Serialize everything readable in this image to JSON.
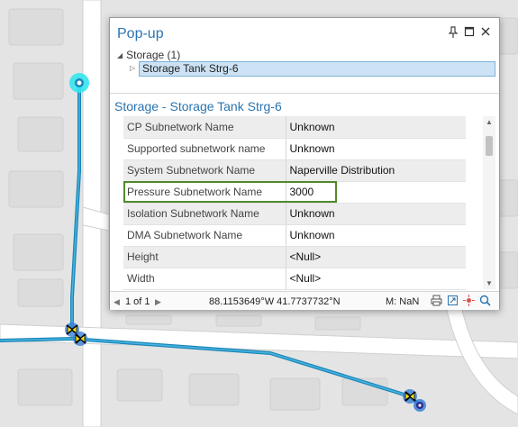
{
  "popup": {
    "title": "Pop-up",
    "layer_label": "Storage (1)",
    "feature_label": "Storage Tank Strg-6",
    "record_title": "Storage - Storage Tank Strg-6",
    "attributes": [
      {
        "name": "CP Subnetwork Name",
        "value": "Unknown"
      },
      {
        "name": "Supported subnetwork name",
        "value": "Unknown"
      },
      {
        "name": "System Subnetwork Name",
        "value": "Naperville Distribution"
      },
      {
        "name": "Pressure Subnetwork Name",
        "value": "3000"
      },
      {
        "name": "Isolation Subnetwork Name",
        "value": "Unknown"
      },
      {
        "name": "DMA Subnetwork Name",
        "value": "Unknown"
      },
      {
        "name": "Height",
        "value": "<Null>"
      },
      {
        "name": "Width",
        "value": "<Null>"
      }
    ],
    "highlighted_attribute": "Pressure Subnetwork Name",
    "status": {
      "page": "1 of 1",
      "coordinates": "88.1153649°W 41.7737732°N",
      "measure": "M: NaN"
    }
  },
  "colors": {
    "accent": "#2a74b0",
    "highlight_border": "#4f8a2b",
    "pipe": "#1a86b8",
    "selection": "#cde3f5"
  },
  "icons": [
    "pin-icon",
    "maximize-icon",
    "close-icon",
    "collapse-icon",
    "expand-icon",
    "prev-icon",
    "next-icon",
    "print-icon",
    "export-icon",
    "flash-icon",
    "zoom-icon",
    "valve-icon",
    "storage-tank-icon"
  ]
}
